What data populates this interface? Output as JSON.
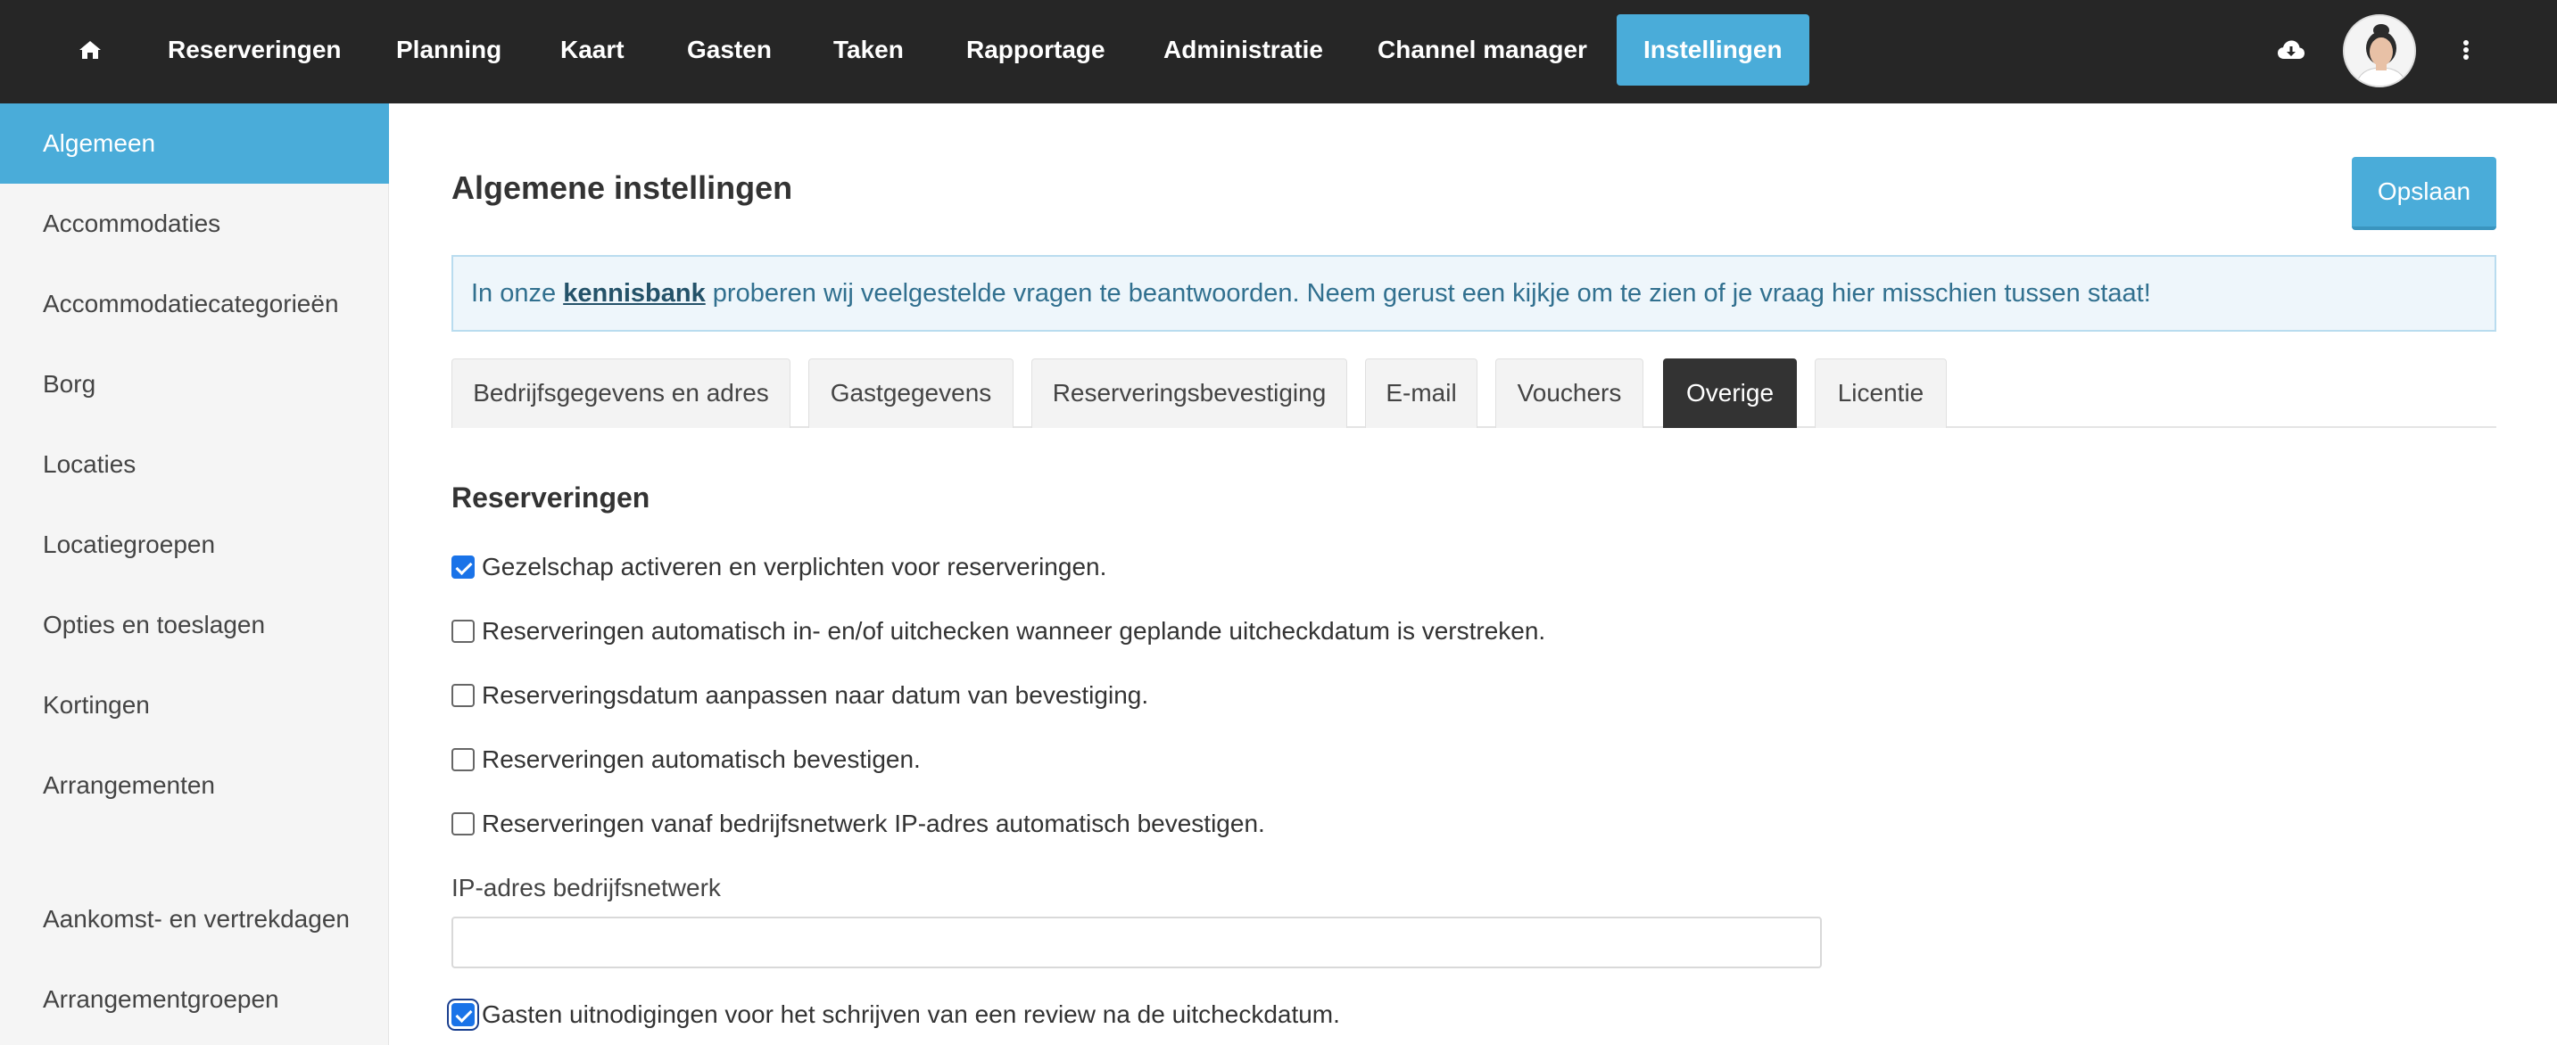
{
  "nav": {
    "items": [
      {
        "label": "Reserveringen"
      },
      {
        "label": "Planning"
      },
      {
        "label": "Kaart"
      },
      {
        "label": "Gasten"
      },
      {
        "label": "Taken"
      },
      {
        "label": "Rapportage"
      },
      {
        "label": "Administratie"
      },
      {
        "label": "Channel manager"
      },
      {
        "label": "Instellingen",
        "active": true
      }
    ]
  },
  "sidebar": {
    "items": [
      {
        "label": "Algemeen",
        "active": true
      },
      {
        "label": "Accommodaties"
      },
      {
        "label": "Accommodatiecategorieën"
      },
      {
        "label": "Borg"
      },
      {
        "label": "Locaties"
      },
      {
        "label": "Locatiegroepen"
      },
      {
        "label": "Opties en toeslagen"
      },
      {
        "label": "Kortingen"
      },
      {
        "label": "Arrangementen"
      },
      {
        "label": "Aankomst- en vertrekdagen"
      },
      {
        "label": "Arrangementgroepen"
      }
    ]
  },
  "main": {
    "title": "Algemene instellingen",
    "save_label": "Opslaan",
    "info": {
      "prefix": "In onze ",
      "link": "kennisbank",
      "suffix": " proberen wij veelgestelde vragen te beantwoorden. Neem gerust een kijkje om te zien of je vraag hier misschien tussen staat!"
    },
    "tabs": [
      {
        "label": "Bedrijfsgegevens en adres"
      },
      {
        "label": "Gastgegevens"
      },
      {
        "label": "Reserveringsbevestiging"
      },
      {
        "label": "E-mail"
      },
      {
        "label": "Vouchers"
      },
      {
        "label": "Overige",
        "active": true
      },
      {
        "label": "Licentie"
      }
    ],
    "section_title": "Reserveringen",
    "options": [
      {
        "label": "Gezelschap activeren en verplichten voor reserveringen.",
        "checked": true
      },
      {
        "label": "Reserveringen automatisch in- en/of uitchecken wanneer geplande uitcheckdatum is verstreken.",
        "checked": false
      },
      {
        "label": "Reserveringsdatum aanpassen naar datum van bevestiging.",
        "checked": false
      },
      {
        "label": "Reserveringen automatisch bevestigen.",
        "checked": false
      },
      {
        "label": "Reserveringen vanaf bedrijfsnetwerk IP-adres automatisch bevestigen.",
        "checked": false
      }
    ],
    "ip_label": "IP-adres bedrijfsnetwerk",
    "ip_value": "",
    "review_option": {
      "label": "Gasten uitnodigingen voor het schrijven van een review na de uitcheckdatum.",
      "checked": true
    }
  },
  "icons": {
    "home": "home-icon",
    "cloud": "cloud-download-icon",
    "more": "more-vertical-icon"
  },
  "colors": {
    "topbar": "#262626",
    "accent": "#4aacd9",
    "active_tab": "#333333",
    "checkbox": "#1a73e8"
  }
}
